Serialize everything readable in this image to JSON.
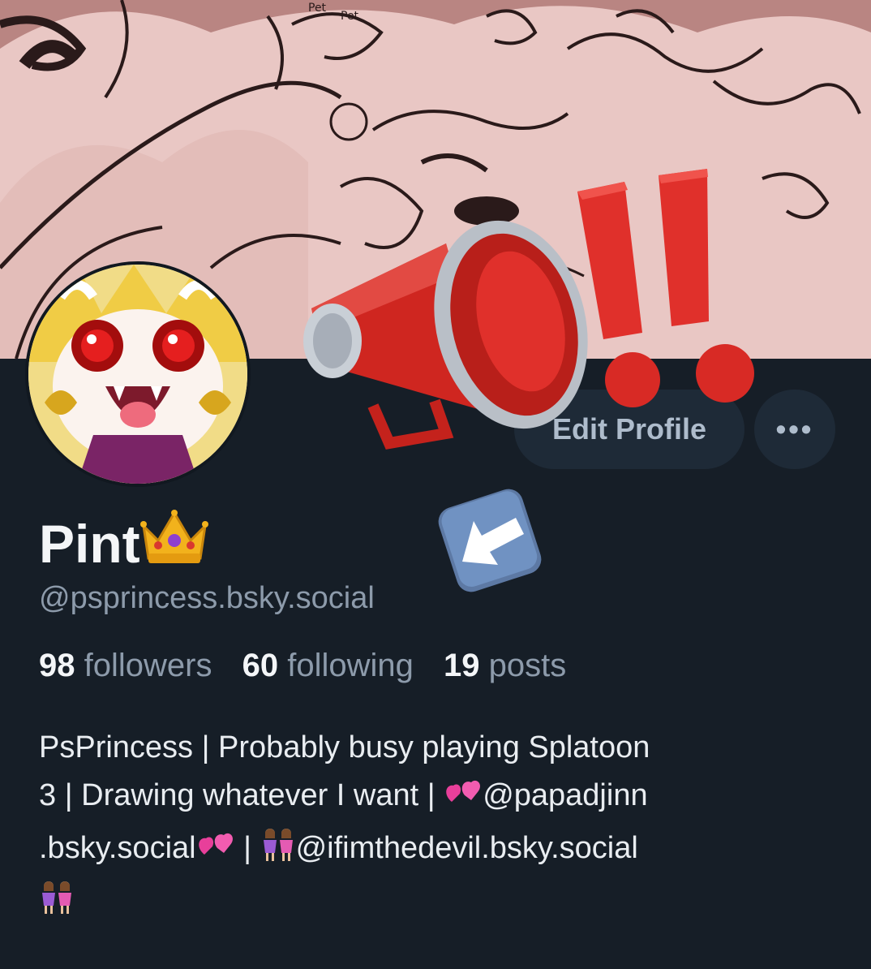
{
  "profile": {
    "display_name": "Pint",
    "handle": "@psprincess.bsky.social",
    "stats": {
      "followers_count": "98",
      "followers_label": "followers",
      "following_count": "60",
      "following_label": "following",
      "posts_count": "19",
      "posts_label": "posts"
    },
    "bio": {
      "line1": "PsPrincess | Probably busy playing Splatoon",
      "line2_a": "3 | Drawing whatever I want | ",
      "line2_b": "@papadjinn",
      "line3_a": ".bsky.social",
      "line3_b": " | ",
      "line3_c": "@ifimthedevil.bsky.social"
    }
  },
  "actions": {
    "edit_profile_label": "Edit Profile",
    "more_label": "•••"
  },
  "banner_text": {
    "pet1": "Pet",
    "pet2": "Pet"
  },
  "icons": {
    "crown": "crown-icon",
    "megaphone": "megaphone-sticker",
    "exclamation": "double-exclamation-sticker",
    "arrow": "arrow-down-left-icon",
    "hearts": "two-hearts-icon",
    "women": "two-women-icon"
  },
  "colors": {
    "background": "#161e27",
    "button_bg": "#1e2a37",
    "muted_text": "#8d9bab",
    "banner_pink": "#e9c7c4",
    "sticker_red": "#e0302b"
  }
}
